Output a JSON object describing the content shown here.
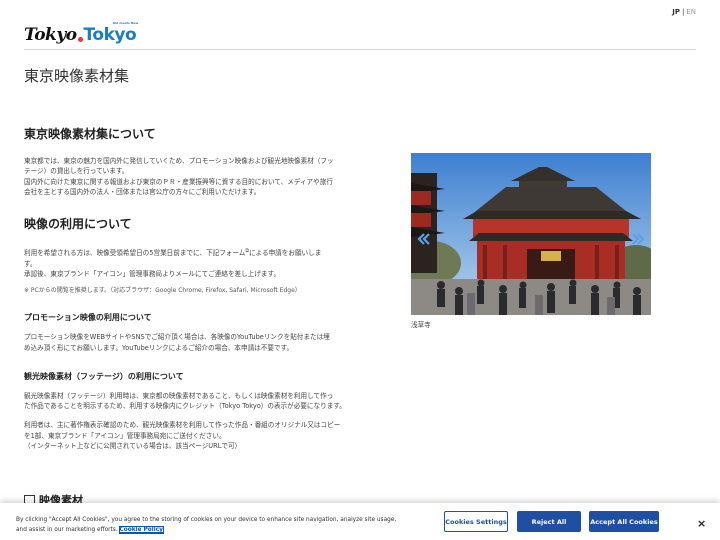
{
  "header": {
    "logo": {
      "part1": "Tokyo",
      "part2": "Tokyo",
      "tagline": "Old meets New"
    },
    "lang": {
      "jp": "JP",
      "separator": "|",
      "en": "EN"
    }
  },
  "page_title": "東京映像素材集",
  "about": {
    "heading": "東京映像素材集について",
    "body_lines": [
      "東京都では、東京の魅力を国内外に発信していくため、プロモーション映像および観光地映像素材（フッ",
      "テージ）の貸出しを行っています。",
      "国内外に向けた東京に関する報道および東京のＰＲ・産業振興等に資する目的において、メディアや旅行",
      "会社を主とする国内外の法人・団体または官公庁の方々にご利用いただけます。"
    ]
  },
  "usage": {
    "heading": "映像の利用について",
    "body_lines": [
      "利用を希望される方は、映像受領希望日の5営業日前までに、下記フォーム",
      "による申請をお願いしま",
      "す。",
      "承認後、東京ブランド「アイコン」管理事務局よりメールにてご連絡を差し上げます。"
    ],
    "note": "※ PCからの閲覧を推奨します。（対応ブラウザ：Google Chrome, Firefox, Safari, Microsoft Edge）"
  },
  "promo": {
    "heading": "プロモーション映像の利用について",
    "body_lines": [
      "プロモーション映像をWEBサイトやSNSでご紹介頂く場合は、各映像のYouTubeリンクを貼付または埋",
      "め込み頂く形にてお願いします。YouTubeリンクによるご紹介の場合、本申請は不要です。"
    ]
  },
  "footage": {
    "heading": "観光映像素材（フッテージ）の利用について",
    "body1_lines": [
      "観光映像素材（フッテージ）利用時は、東京都の映像素材であること、もしくは映像素材を利用して作っ",
      "た作品であることを明示するため、利用する映像内にクレジット（Tokyo Tokyo）の表示が必要になります。"
    ],
    "body2_lines": [
      "利用者は、主に著作権表示確認のため、観光映像素材を利用して作った作品・番組のオリジナル又はコピー",
      "を1部、東京ブランド「アイコン」管理事務局宛にご送付ください。",
      "（インターネット上などに公開されている場合は、該当ページURLで可）"
    ]
  },
  "slideshow": {
    "caption": "浅草寺"
  },
  "next_section": {
    "heading": "映像素材"
  },
  "cookie": {
    "text": "By clicking \"Accept All Cookies\", you agree to the storing of cookies on your device to enhance site navigation, analyze site usage, and assist in our marketing efforts.",
    "policy_link": "Cookie Policy",
    "settings_label": "Cookies Settings",
    "reject_label": "Reject All",
    "accept_label": "Accept All Cookies",
    "close_symbol": "×"
  },
  "colors": {
    "accent": "#1f4fa3",
    "logo_blue": "#1a7dc1",
    "logo_dot": "#e33333"
  }
}
